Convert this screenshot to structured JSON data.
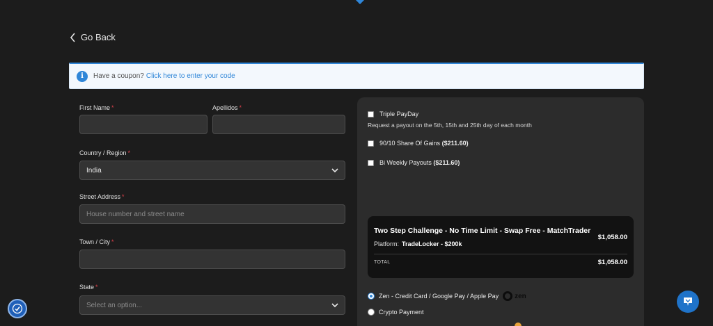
{
  "nav": {
    "go_back": "Go Back"
  },
  "coupon": {
    "text": "Have a coupon?",
    "link": "Click here to enter your code"
  },
  "form": {
    "first_name": {
      "label": "First Name",
      "value": ""
    },
    "apellidos": {
      "label": "Apellidos",
      "value": ""
    },
    "country": {
      "label": "Country / Region",
      "value": "India"
    },
    "street": {
      "label": "Street Address",
      "placeholder": "House number and street name"
    },
    "town": {
      "label": "Town / City",
      "value": ""
    },
    "state": {
      "label": "State",
      "placeholder": "Select an option..."
    },
    "required_mark": "*"
  },
  "addons": {
    "triple": {
      "label": "Triple PayDay",
      "checked": false,
      "description": "Request a payout on the 5th, 15th and 25th day of each month"
    },
    "share": {
      "label": "90/10 Share Of Gains",
      "price": "($211.60)",
      "checked": false
    },
    "biweekly": {
      "label": "Bi Weekly Payouts",
      "price": "($211.60)",
      "checked": false
    }
  },
  "summary": {
    "title": "Two Step Challenge - No Time Limit - Swap Free - MatchTrader",
    "platform_label": "Platform:",
    "platform_value": "TradeLocker - $200k",
    "price": "$1,058.00",
    "total_label": "TOTAL",
    "total": "$1,058.00"
  },
  "payment": {
    "zen": {
      "label": "Zen - Credit Card / Google Pay / Apple Pay",
      "logo_text": "zen",
      "selected": true
    },
    "crypto": {
      "label": "Crypto Payment",
      "selected": false
    }
  },
  "colors": {
    "accent": "#2f86d8",
    "background": "#1c1c1c",
    "panel": "#2c2c2c",
    "required": "#e0414b"
  }
}
